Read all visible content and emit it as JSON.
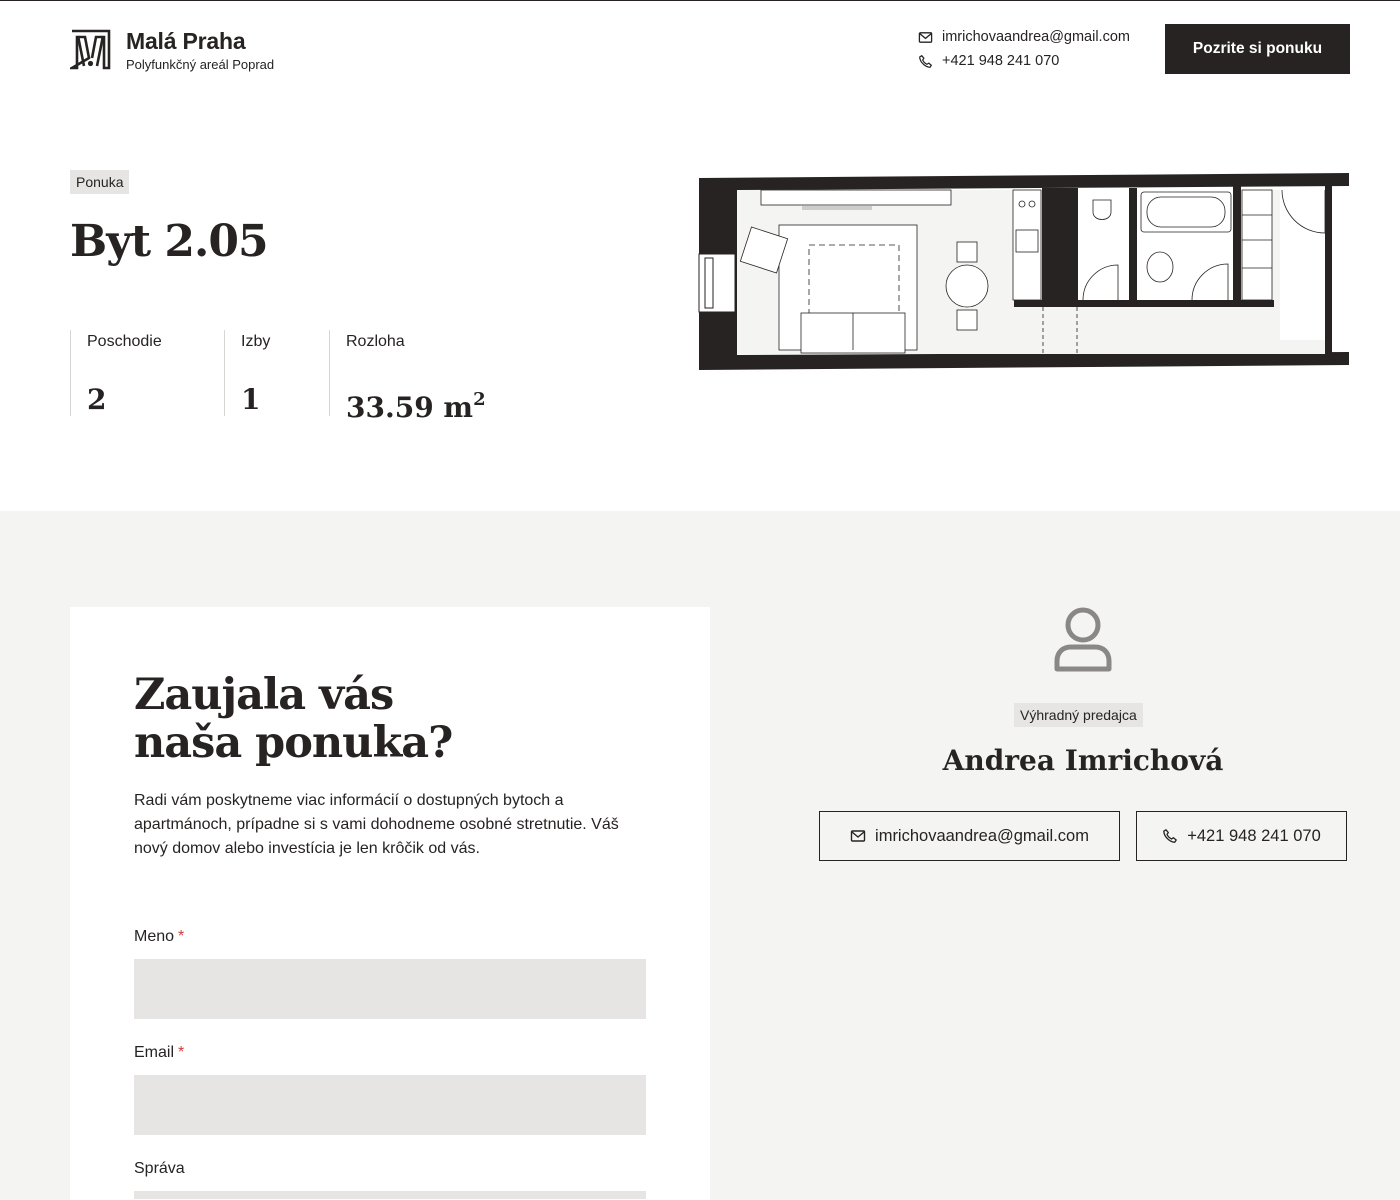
{
  "header": {
    "brand_name": "Malá Praha",
    "brand_subtitle": "Polyfunkčný areál Poprad",
    "email": "imrichovaandrea@gmail.com",
    "phone": "+421 948 241 070",
    "cta_label": "Pozrite si ponuku"
  },
  "hero": {
    "tag": "Ponuka",
    "title": "Byt 2.05",
    "stats": [
      {
        "label": "Poschodie",
        "value": "2"
      },
      {
        "label": "Izby",
        "value": "1"
      },
      {
        "label": "Rozloha",
        "value": "33.59 m",
        "unit_sup": "2"
      }
    ]
  },
  "contact_form": {
    "title_line1": "Zaujala vás",
    "title_line2": "naša ponuka?",
    "description": "Radi vám poskytneme viac informácií o dostupných bytoch a apartmánoch, prípadne si s vami dohodneme osobné stretnutie. Váš nový domov alebo investícia je len krôčik od vás.",
    "fields": [
      {
        "label": "Meno",
        "required_mark": "*",
        "value": ""
      },
      {
        "label": "Email",
        "required_mark": "*",
        "value": ""
      },
      {
        "label": "Správa",
        "value": ""
      }
    ]
  },
  "agent": {
    "tag": "Výhradný predajca",
    "name": "Andrea Imrichová",
    "email": "imrichovaandrea@gmail.com",
    "phone": "+421 948 241 070"
  },
  "colors": {
    "dark": "#262322",
    "light_bg": "#f4f4f2",
    "input_bg": "#e6e5e3",
    "required": "#d9383a"
  },
  "icons": [
    "logo-mark-icon",
    "mail-icon",
    "phone-icon",
    "user-icon",
    "floor-plan-icon"
  ]
}
